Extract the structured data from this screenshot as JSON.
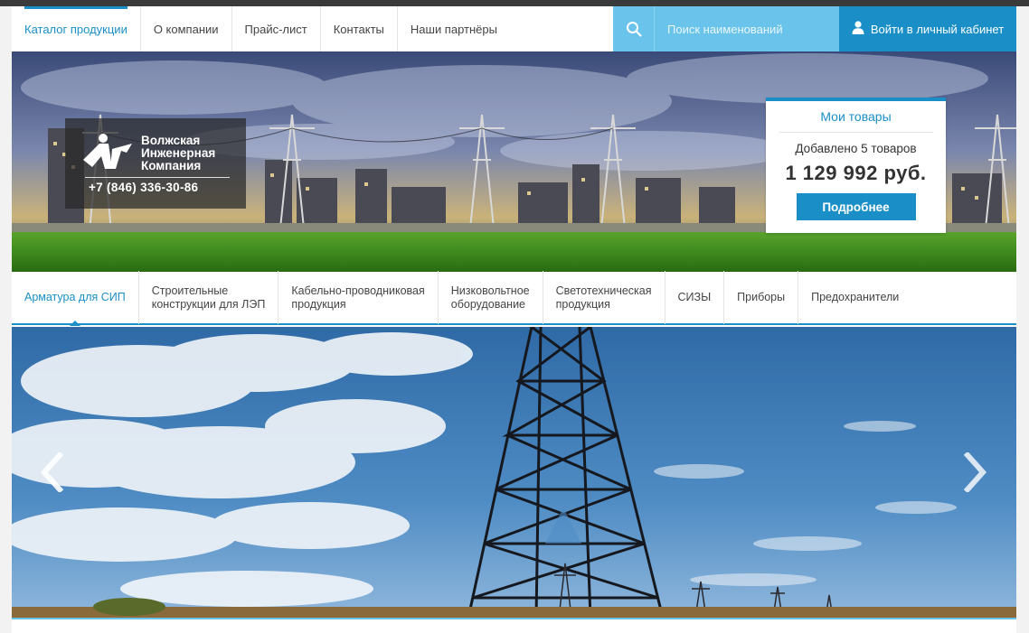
{
  "topnav": {
    "items": [
      {
        "label": "Каталог продукции",
        "active": true
      },
      {
        "label": "О компании",
        "active": false
      },
      {
        "label": "Прайс-лист",
        "active": false
      },
      {
        "label": "Контакты",
        "active": false
      },
      {
        "label": "Наши партнёры",
        "active": false
      }
    ],
    "search_placeholder": "Поиск наименований",
    "login_label": "Войти в личный кабинет"
  },
  "logo": {
    "name_line1": "Волжская",
    "name_line2": "Инженерная",
    "name_line3": "Компания",
    "phone": "+7 (846) 336-30-86"
  },
  "cart": {
    "title": "Мои товары",
    "added": "Добавлено 5 товаров",
    "sum": "1 129 992 руб.",
    "button": "Подробнее"
  },
  "categories": [
    {
      "label": "Арматура для СИП",
      "active": true
    },
    {
      "label": "Строительные\nконструкции для ЛЭП",
      "active": false
    },
    {
      "label": "Кабельно-проводниковая\nпродукция",
      "active": false
    },
    {
      "label": "Низковольтное\nоборудование",
      "active": false
    },
    {
      "label": "Светотехническая\nпродукция",
      "active": false
    },
    {
      "label": "СИЗЫ",
      "active": false
    },
    {
      "label": "Приборы",
      "active": false
    },
    {
      "label": "Предохранители",
      "active": false
    }
  ],
  "colors": {
    "accent": "#1a8fc7",
    "search_bg": "#69c3ea",
    "text": "#444444"
  },
  "icons": {
    "search": "search-icon",
    "user": "user-icon",
    "prev": "chevron-left-icon",
    "next": "chevron-right-icon"
  }
}
